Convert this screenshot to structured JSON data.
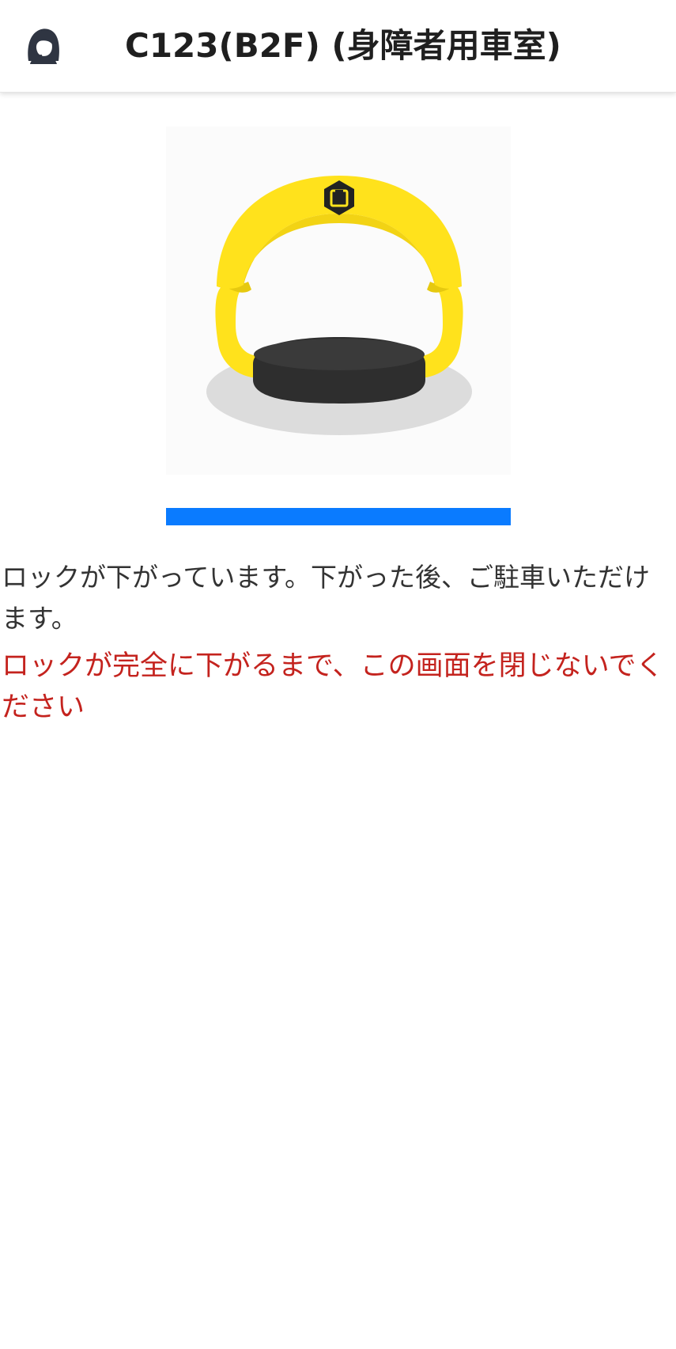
{
  "header": {
    "title": "C123(B2F) (身障者用車室)",
    "support_icon": "customer-support-headset-icon"
  },
  "illustration": {
    "name": "parking-lock-device",
    "colors": {
      "arm": "#ffe21c",
      "base": "#333333",
      "shadow": "#dcdcdc",
      "logo": "#222222"
    }
  },
  "progress": {
    "fraction": 1.0,
    "color": "#0a7bff"
  },
  "messages": {
    "info": "ロックが下がっています。下がった後、ご駐車いただけます。",
    "warning": "ロックが完全に下がるまで、この画面を閉じないでください",
    "warning_color": "#c4231e"
  }
}
